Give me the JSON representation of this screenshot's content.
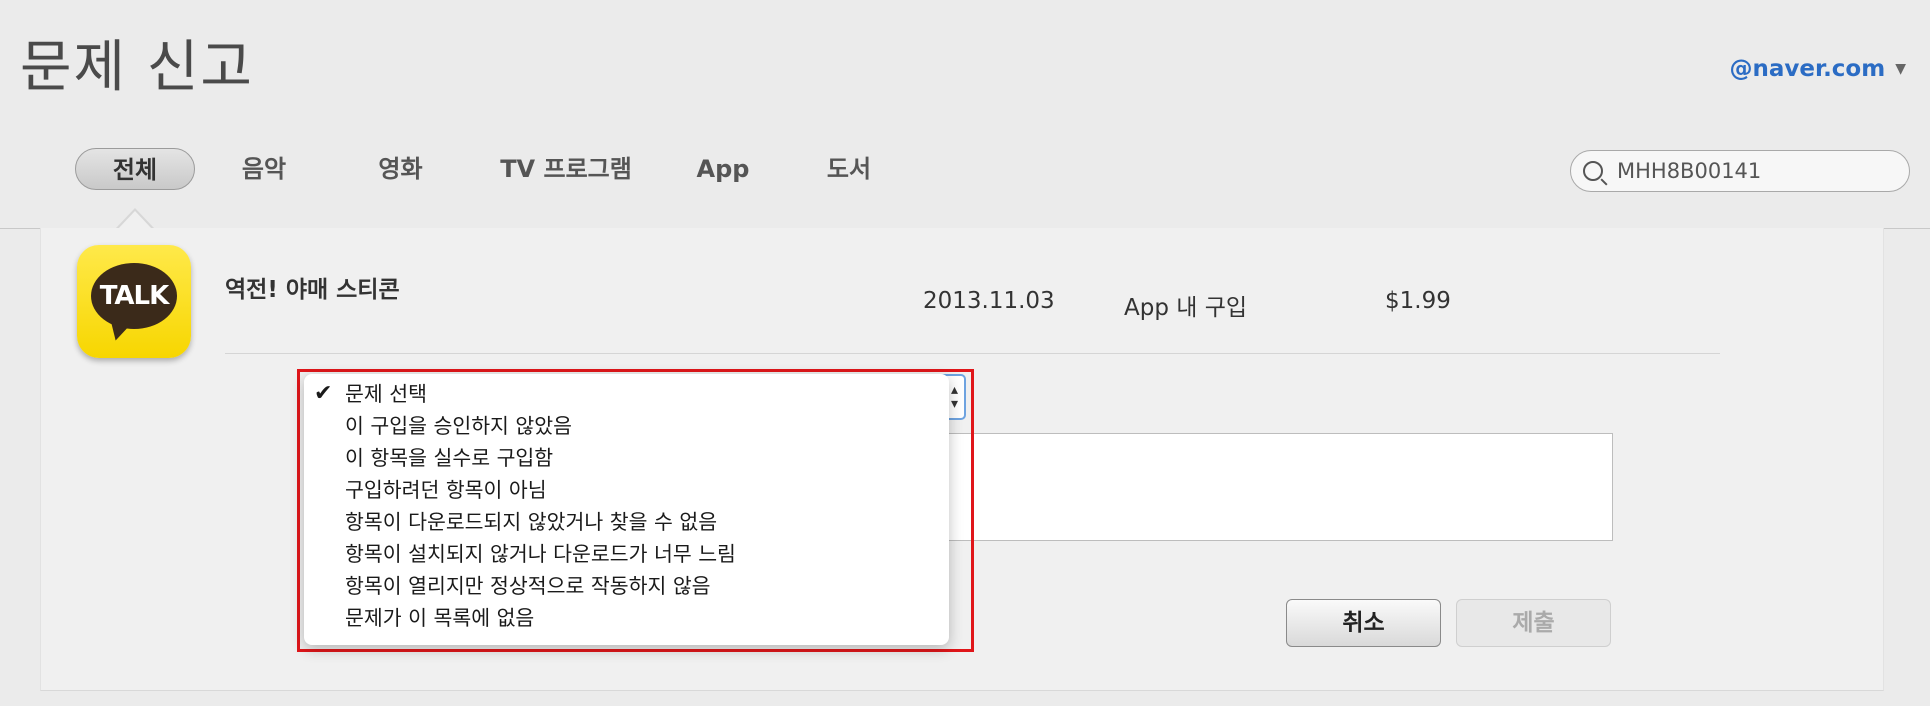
{
  "header": {
    "title": "문제 신고",
    "account": "@naver.com"
  },
  "tabs": [
    {
      "label": "전체",
      "active": true
    },
    {
      "label": "음악",
      "active": false
    },
    {
      "label": "영화",
      "active": false
    },
    {
      "label": "TV 프로그램",
      "active": false
    },
    {
      "label": "App",
      "active": false
    },
    {
      "label": "도서",
      "active": false
    }
  ],
  "search": {
    "value": "MHH8B00141"
  },
  "item": {
    "icon_text": "TALK",
    "name": "역전! 야매 스티콘",
    "date": "2013.11.03",
    "type": "App 내 구입",
    "price": "$1.99"
  },
  "problem_dropdown": {
    "selected": "문제 선택",
    "options": [
      "문제 선택",
      "이 구입을 승인하지 않았음",
      "이 항목을 실수로 구입함",
      "구입하려던 항목이 아님",
      "항목이 다운로드되지 않았거나 찾을 수 없음",
      "항목이 설치되지 않거나 다운로드가 너무 느림",
      "항목이 열리지만 정상적으로 작동하지 않음",
      "문제가 이 목록에 없음"
    ]
  },
  "buttons": {
    "cancel": "취소",
    "submit": "제출"
  },
  "colors": {
    "accent_link": "#2b6cc4",
    "highlight_border": "#e0161a",
    "focus_ring": "#6ea3e0"
  }
}
